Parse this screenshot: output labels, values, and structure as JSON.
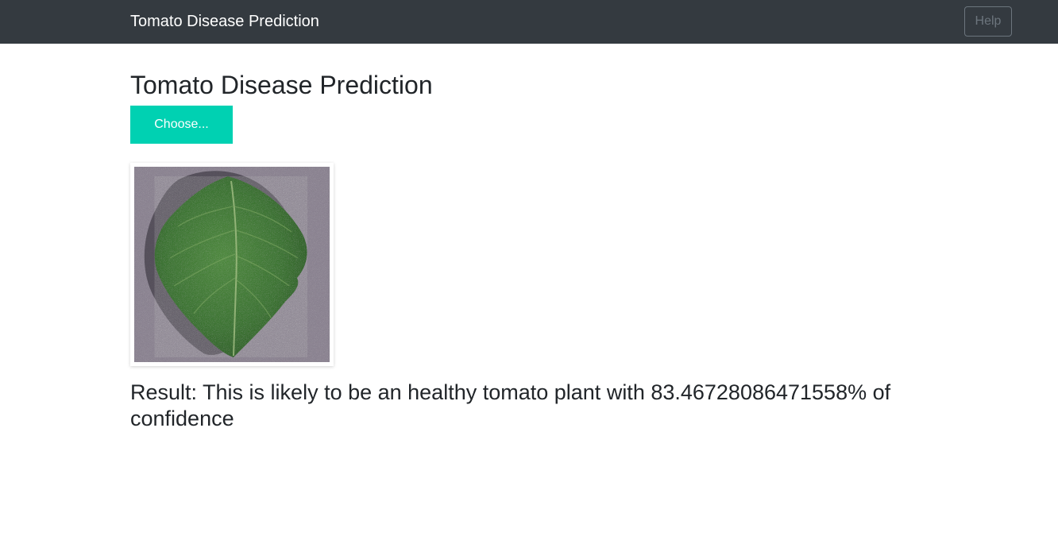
{
  "navbar": {
    "brand": "Tomato Disease Prediction",
    "help_label": "Help"
  },
  "main": {
    "title": "Tomato Disease Prediction",
    "choose_label": "Choose...",
    "result_text": "Result: This is likely to be an healthy tomato plant with 83.46728086471558% of confidence"
  },
  "colors": {
    "navbar_bg": "#343a40",
    "accent": "#00d1b2",
    "leaf": "#3f7a35",
    "background_surface": "#8c8390"
  },
  "icons": {
    "preview": "tomato-leaf-image"
  }
}
